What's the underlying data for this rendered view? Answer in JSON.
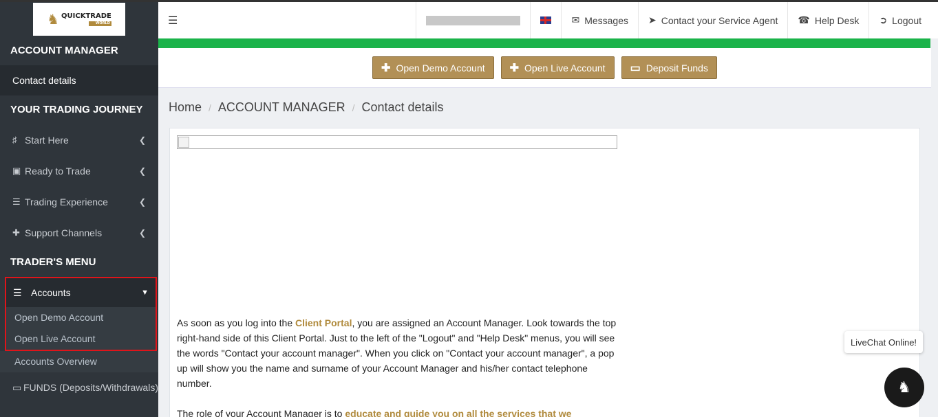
{
  "brand": {
    "name": "QUICKTRADE",
    "sub": "WORLD"
  },
  "sidebar": {
    "section1": "ACCOUNT MANAGER",
    "contact_details": "Contact details",
    "section2": "YOUR TRADING JOURNEY",
    "journey": [
      {
        "label": "Start Here",
        "icon": "person-icon"
      },
      {
        "label": "Ready to Trade",
        "icon": "briefcase-icon"
      },
      {
        "label": "Trading Experience",
        "icon": "coins-icon"
      },
      {
        "label": "Support Channels",
        "icon": "medkit-icon"
      }
    ],
    "section3": "TRADER'S MENU",
    "accounts": "Accounts",
    "accounts_sub": [
      "Open Demo Account",
      "Open Live Account"
    ],
    "accounts_overview": "Accounts Overview",
    "funds": "FUNDS (Deposits/Withdrawals)"
  },
  "topbar": {
    "messages": "Messages",
    "contact_agent": "Contact your Service Agent",
    "help_desk": "Help Desk",
    "logout": "Logout"
  },
  "actions": {
    "open_demo": "Open Demo Account",
    "open_live": "Open Live Account",
    "deposit": "Deposit Funds"
  },
  "breadcrumb": {
    "home": "Home",
    "section": "ACCOUNT MANAGER",
    "page": "Contact details"
  },
  "content": {
    "p1_before": "As soon as you log into the ",
    "p1_link": "Client Portal",
    "p1_after": ", you are assigned an Account Manager. Look towards the top right-hand side of this Client Portal. Just to the left of the \"Logout\" and \"Help Desk\" menus, you will see the words \"Contact your account manager\". When you click on \"Contact your account manager\", a pop up will show you the name and surname of your Account Manager and his/her contact telephone number.",
    "p2_before": "The role of your Account Manager is to ",
    "p2_hl": "educate and guide you on all the services that we"
  },
  "livechat": {
    "label": "LiveChat Online!"
  },
  "colors": {
    "accent": "#b29056",
    "green": "#1bb34a",
    "sidebar": "#2f353b",
    "highlight_border": "#e0141a"
  }
}
